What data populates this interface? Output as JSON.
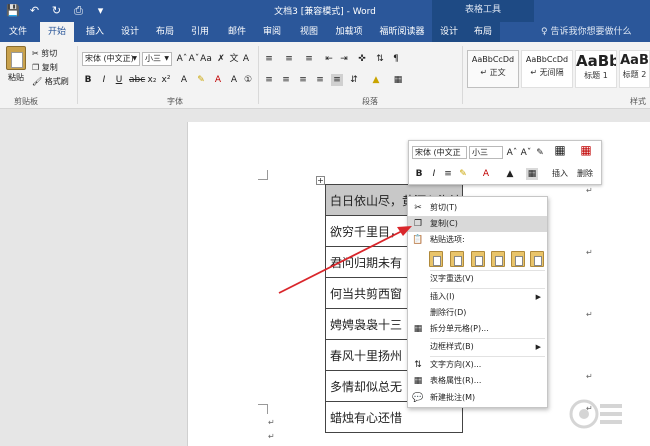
{
  "titlebar": {
    "title": "文档3 [兼容模式] - Word",
    "table_tools": "表格工具"
  },
  "ribbon_tabs": [
    "文件",
    "开始",
    "插入",
    "设计",
    "布局",
    "引用",
    "邮件",
    "审阅",
    "视图",
    "加载项",
    "福昕阅读器",
    "设计",
    "布局"
  ],
  "active_tab_index": 1,
  "tell_me": "♀ 告诉我你想要做什么",
  "clipboard": {
    "paste": "粘贴",
    "cut": "剪切",
    "copy": "复制",
    "format_painter": "格式刷",
    "group_label": "剪贴板"
  },
  "font": {
    "font_name": "宋体 (中文正)",
    "font_size": "小三",
    "group_label": "字体"
  },
  "paragraph": {
    "group_label": "段落"
  },
  "styles": {
    "items": [
      {
        "sample": "AaBbCcDd",
        "name": "↵ 正文"
      },
      {
        "sample": "AaBbCcDd",
        "name": "↵ 无间隔"
      },
      {
        "sample": "AaBb",
        "name": "标题 1"
      },
      {
        "sample": "AaB",
        "name": "标题 2"
      }
    ],
    "group_label": "样式"
  },
  "table_rows": [
    "白日依山尽，黄河入海流",
    "欲穷千里目，",
    "君问归期未有",
    "何当共剪西窗",
    "娉娉袅袅十三",
    "春风十里扬州",
    "多情却似总无",
    "蜡烛有心还惜"
  ],
  "mini_toolbar": {
    "font_name": "宋体 (中文正",
    "font_size": "小三",
    "insert": "插入",
    "delete": "删除"
  },
  "context_menu": {
    "cut": "剪切(T)",
    "copy": "复制(C)",
    "paste_options": "粘贴选项:",
    "han_reselect": "汉字重选(V)",
    "insert": "插入(I)",
    "delete_row": "删除行(D)",
    "split_cells": "拆分单元格(P)...",
    "border_styles": "边框样式(B)",
    "text_direction": "文字方向(X)...",
    "table_properties": "表格属性(R)...",
    "new_comment": "新建批注(M)"
  },
  "colors": {
    "word_blue": "#2b579a",
    "arrow_red": "#d9262b",
    "highlight": "#d9d9d9"
  }
}
